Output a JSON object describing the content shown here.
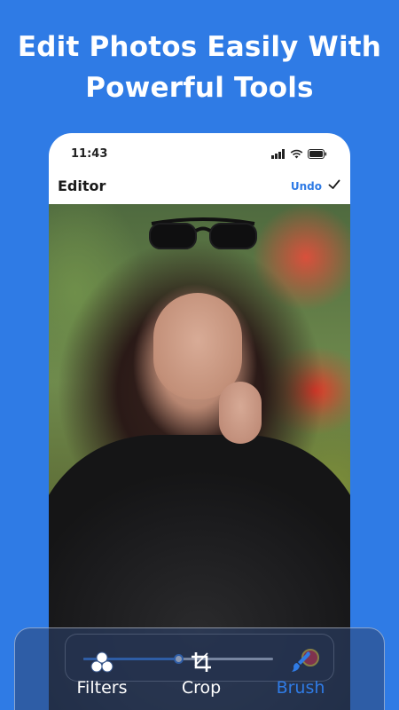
{
  "headline": {
    "line1": "Edit Photos Easily With",
    "line2": "Powerful Tools"
  },
  "status_bar": {
    "time": "11:43",
    "icons": [
      "signal-icon",
      "wifi-icon",
      "battery-icon"
    ]
  },
  "editor": {
    "title": "Editor",
    "undo_label": "Undo",
    "confirm_icon": "check-icon"
  },
  "brush_controls": {
    "size_level": 0.5,
    "color": "#e31b23"
  },
  "toolbar": {
    "items": [
      {
        "label": "Filters",
        "icon": "filters-icon",
        "active": false
      },
      {
        "label": "Crop",
        "icon": "crop-icon",
        "active": false
      },
      {
        "label": "Brush",
        "icon": "brush-icon",
        "active": true
      }
    ]
  },
  "colors": {
    "background": "#2f7be5",
    "accent": "#2f7be5",
    "active_tool": "#2f7be5"
  }
}
